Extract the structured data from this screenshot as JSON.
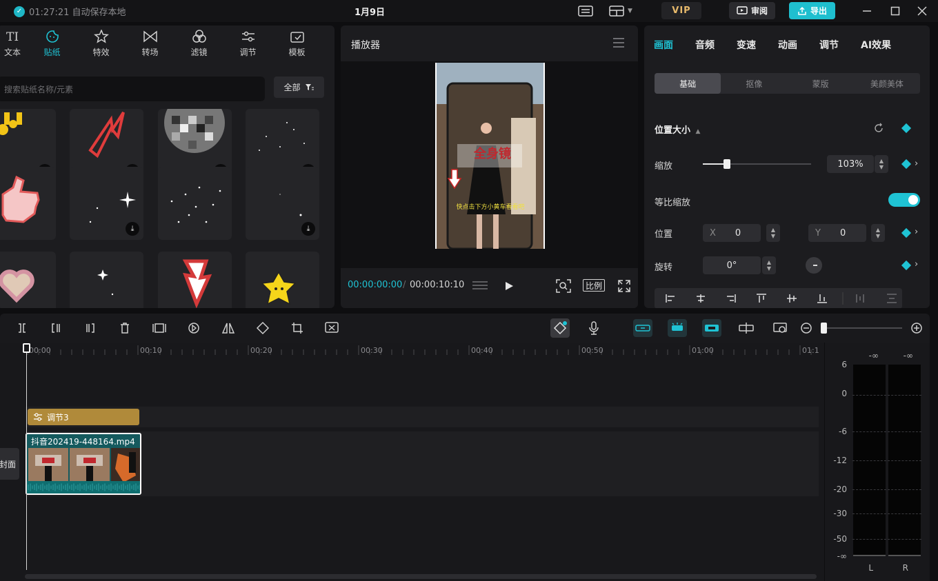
{
  "titlebar": {
    "save_status": "01:27:21 自动保存本地",
    "title": "1月9日",
    "vip": "VIP",
    "review": "审阅",
    "export": "导出"
  },
  "left_tabs": [
    {
      "label": "文本",
      "icon": "text-icon"
    },
    {
      "label": "贴纸",
      "icon": "sticker-icon"
    },
    {
      "label": "特效",
      "icon": "effects-icon"
    },
    {
      "label": "转场",
      "icon": "transition-icon"
    },
    {
      "label": "滤镜",
      "icon": "filter-icon"
    },
    {
      "label": "调节",
      "icon": "adjust-icon"
    },
    {
      "label": "模板",
      "icon": "template-icon"
    }
  ],
  "search": {
    "placeholder": "搜索贴纸名称/元素",
    "filter_label": "全部"
  },
  "player": {
    "title": "播放器",
    "current_time": "00:00:00:00",
    "sep": "/",
    "total_time": "00:00:10:10",
    "ratio_label": "比例",
    "overlay_title": "全身镜",
    "overlay_caption": "快点击下方小黄车看看吧"
  },
  "right_tabs": [
    "画面",
    "音频",
    "变速",
    "动画",
    "调节",
    "AI效果"
  ],
  "sub_tabs": [
    "基础",
    "抠像",
    "蒙版",
    "美颜美体"
  ],
  "props": {
    "section": "位置大小",
    "scale_label": "缩放",
    "scale_value": "103%",
    "uniform_label": "等比缩放",
    "position_label": "位置",
    "x_label": "X",
    "x_value": "0",
    "y_label": "Y",
    "y_value": "0",
    "rotate_label": "旋转",
    "rotate_value": "0°"
  },
  "ruler": [
    "00:00",
    "00:10",
    "00:20",
    "00:30",
    "00:40",
    "00:50",
    "01:00",
    "01:1"
  ],
  "tracks": {
    "adjust_clip": "调节3",
    "video_clip": "抖音202419-448164.mp4",
    "cover_label": "封面"
  },
  "meter": {
    "top_l": "-∞",
    "top_r": "-∞",
    "scale": [
      "6",
      "0",
      "-6",
      "-12",
      "-20",
      "-30",
      "-50",
      "-∞"
    ],
    "left": "L",
    "right": "R"
  },
  "colors": {
    "accent": "#1fc3d4",
    "adjust_clip": "#b08a3a",
    "video_clip": "#155a5e"
  }
}
